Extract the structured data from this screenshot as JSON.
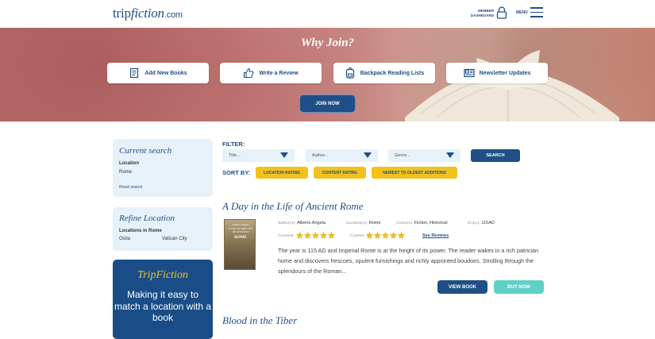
{
  "header": {
    "logo_main": "trip",
    "logo_italic": "fiction",
    "logo_suffix": ".com",
    "member_line1": "MEMBER",
    "member_line2": "DASHBOARD",
    "menu_label": "MENU"
  },
  "hero": {
    "heading": "Why Join?",
    "buttons": [
      {
        "label": "Add New Books",
        "icon": "book-icon"
      },
      {
        "label": "Write a Review",
        "icon": "thumbs-up-icon"
      },
      {
        "label": "Backpack Reading Lists",
        "icon": "backpack-icon"
      },
      {
        "label": "Newsletter Updates",
        "icon": "newsletter-icon"
      }
    ],
    "join_label": "JOIN NOW"
  },
  "sidebar": {
    "current_search": {
      "title": "Current search",
      "location_label": "Location",
      "location_value": "Rome",
      "reset_label": "Reset search"
    },
    "refine": {
      "title": "Refine Location",
      "locations_label": "Locations in Rome",
      "options": [
        "Ostia",
        "Vatican City"
      ]
    },
    "promo": {
      "brand": "TripFiction",
      "text": "Making it easy to match a location with a book"
    }
  },
  "filter": {
    "label": "FILTER:",
    "title_placeholder": "Title...",
    "author_placeholder": "Author...",
    "genre_placeholder": "Genre...",
    "search_label": "SEARCH"
  },
  "sort": {
    "label": "SORT BY:",
    "options": [
      "LOCATION RATING",
      "CONTENT RATING",
      "NEWEST TO OLDEST ADDITIONS"
    ]
  },
  "results": [
    {
      "title": "A Day in the Life of Ancient Rome",
      "cover_author": "Alberto Angela",
      "cover_title": "A DAY IN THE LIFE OF ANCIENT",
      "cover_big": "ROME",
      "author_key": "Author(s):",
      "author": "Alberto Angela",
      "location_key": "Location(s):",
      "location": "Rome",
      "genre_key": "Genre(s):",
      "genre": "Fiction, Historical",
      "era_key": "Era(s):",
      "era": "115AD",
      "location_rating_key": "Location",
      "location_rating": 5,
      "content_rating_key": "Content",
      "content_rating": 5,
      "see_reviews": "See Reviews",
      "description": "The year is 115 AD and Imperial Rome is at the height of its power. The reader wakes in a rich patrician home and discovers frescoes, opulent furnishings and richly appointed boudoirs. Strolling through the splendours of the Roman...",
      "view_label": "VIEW BOOK",
      "buy_label": "BUY NOW"
    },
    {
      "title": "Blood in the Tiber"
    }
  ],
  "colors": {
    "brand_blue": "#1f4f86",
    "accent_yellow": "#f2c21a",
    "accent_teal": "#5fd0c5",
    "panel_bg": "#e7f1fa"
  }
}
